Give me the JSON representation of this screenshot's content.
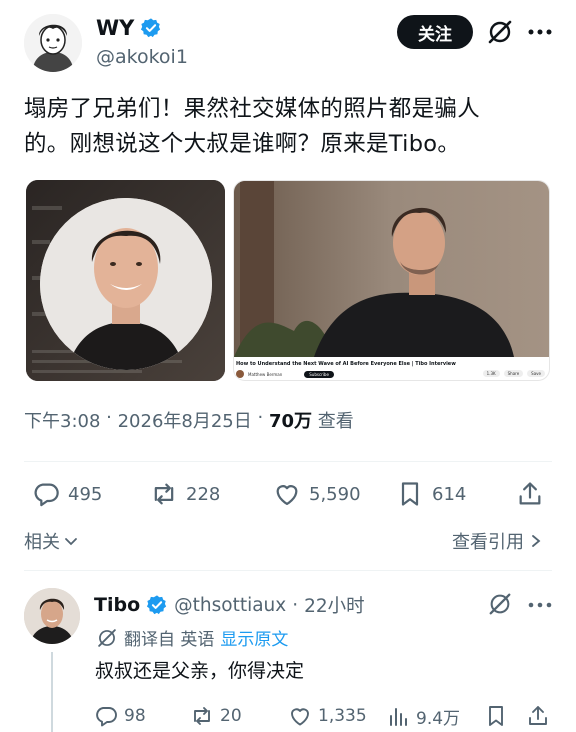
{
  "tweet": {
    "author": {
      "display_name": "WY",
      "handle": "@akokoi1",
      "verified": true
    },
    "follow_label": "关注",
    "text_line1": "塌房了兄弟们！果然社交媒体的照片都是骗人",
    "text_line2": "的。刚想说这个大叔是谁啊？原来是Tibo。",
    "media": [
      {
        "kind": "profile-photo"
      },
      {
        "kind": "video-thumbnail",
        "video_title": "How to Understand the Next Wave of AI Before Everyone Else | Tibo Interview",
        "channel": "Matthew Berman",
        "subscribe_label": "Subscribe",
        "likes": "1.3K",
        "share_label": "Share",
        "save_label": "Save"
      }
    ],
    "time": "下午3:08",
    "date": "2026年8月25日",
    "views": "70万",
    "views_label": "查看",
    "stats": {
      "replies": "495",
      "reposts": "228",
      "likes": "5,590",
      "bookmarks": "614"
    },
    "related_label": "相关",
    "quote_label": "查看引用"
  },
  "reply": {
    "author": {
      "display_name": "Tibo",
      "handle": "@thsottiaux",
      "verified": true
    },
    "time": "22小时",
    "translated_from": "翻译自 英语",
    "show_original": "显示原文",
    "text": "叔叔还是父亲，你得决定",
    "stats": {
      "replies": "98",
      "reposts": "20",
      "likes": "1,335",
      "views": "9.4万"
    }
  },
  "colors": {
    "text": "#0f1419",
    "secondary": "#536471",
    "accent": "#1d9bf0",
    "verified": "#1d9bf0"
  },
  "icons": [
    "grok-icon",
    "more-icon",
    "reply-icon",
    "repost-icon",
    "like-icon",
    "bookmark-icon",
    "share-icon",
    "views-icon",
    "chevron-down-icon",
    "chevron-right-icon",
    "verified-badge-icon"
  ]
}
